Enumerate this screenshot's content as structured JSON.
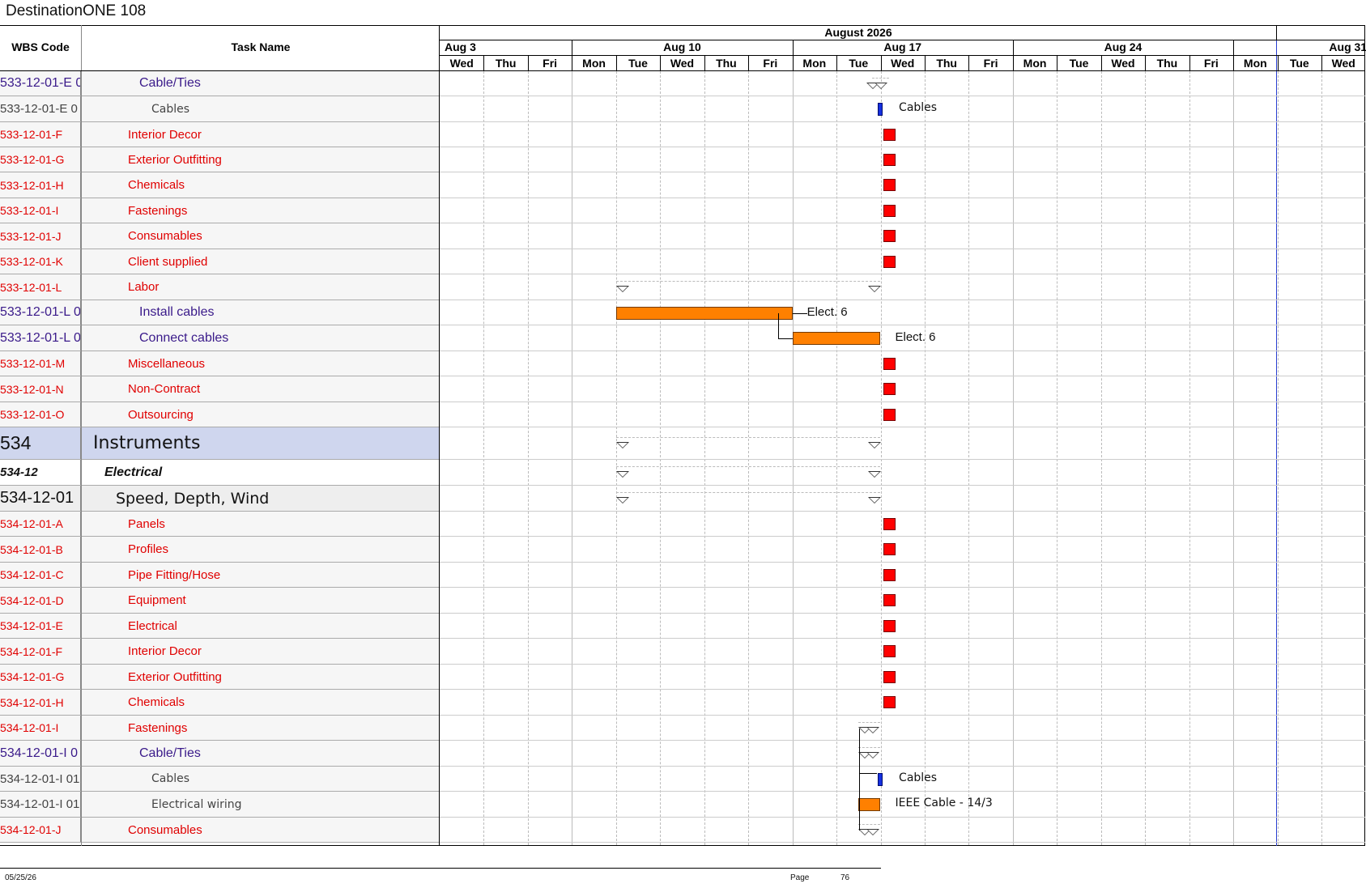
{
  "title": "DestinationONE 108",
  "header": {
    "wbs_label": "WBS Code",
    "task_label": "Task Name",
    "month": "August 2026",
    "weeks": [
      "Aug 3",
      "Aug 10",
      "Aug 17",
      "Aug 24",
      "Aug 31"
    ],
    "days": [
      "Wed",
      "Thu",
      "Fri",
      "Mon",
      "Tue",
      "Wed",
      "Thu",
      "Fri",
      "Mon",
      "Tue",
      "Wed",
      "Thu",
      "Fri",
      "Mon",
      "Tue",
      "Wed",
      "Thu",
      "Fri",
      "Mon",
      "Tue",
      "Wed"
    ]
  },
  "rows": [
    {
      "wbs": "533-12-01-E 0",
      "task": "Cable/Ties",
      "style": "sub",
      "marker": "sumtri",
      "start": 9.8,
      "end": 10.2
    },
    {
      "wbs": "533-12-01-E 0",
      "task": "Cables",
      "style": "item",
      "marker": "blue",
      "start": 9.9,
      "label": "Cables"
    },
    {
      "wbs": "533-12-01-F",
      "task": "Interior Decor",
      "style": "red",
      "marker": "ms",
      "start": 10
    },
    {
      "wbs": "533-12-01-G",
      "task": "Exterior Outfitting",
      "style": "red",
      "marker": "ms",
      "start": 10
    },
    {
      "wbs": "533-12-01-H",
      "task": "Chemicals",
      "style": "red",
      "marker": "ms",
      "start": 10
    },
    {
      "wbs": "533-12-01-I",
      "task": "Fastenings",
      "style": "red",
      "marker": "ms",
      "start": 10
    },
    {
      "wbs": "533-12-01-J",
      "task": "Consumables",
      "style": "red",
      "marker": "ms",
      "start": 10
    },
    {
      "wbs": "533-12-01-K",
      "task": "Client supplied",
      "style": "red",
      "marker": "ms",
      "start": 10
    },
    {
      "wbs": "533-12-01-L",
      "task": "Labor",
      "style": "red",
      "marker": "sum",
      "start": 4,
      "end": 10
    },
    {
      "wbs": "533-12-01-L 0",
      "task": "Install cables",
      "style": "sub",
      "marker": "bar",
      "start": 4,
      "end": 8,
      "label": "Elect. 6"
    },
    {
      "wbs": "533-12-01-L 0",
      "task": "Connect cables",
      "style": "sub",
      "marker": "bar",
      "start": 8,
      "end": 10,
      "label": "Elect. 6"
    },
    {
      "wbs": "533-12-01-M",
      "task": "Miscellaneous",
      "style": "red",
      "marker": "ms",
      "start": 10
    },
    {
      "wbs": "533-12-01-N",
      "task": "Non-Contract",
      "style": "red",
      "marker": "ms",
      "start": 10
    },
    {
      "wbs": "533-12-01-O",
      "task": "Outsourcing",
      "style": "red",
      "marker": "ms",
      "start": 10
    },
    {
      "wbs": "534",
      "task": "Instruments",
      "style": "l1",
      "marker": "sum",
      "start": 4,
      "end": 10
    },
    {
      "wbs": "534-12",
      "task": "Electrical",
      "style": "l2",
      "marker": "sum",
      "start": 4,
      "end": 10
    },
    {
      "wbs": "534-12-01",
      "task": "Speed, Depth, Wind",
      "style": "l3",
      "marker": "sum",
      "start": 4,
      "end": 10
    },
    {
      "wbs": "534-12-01-A",
      "task": "Panels",
      "style": "red",
      "marker": "ms",
      "start": 10
    },
    {
      "wbs": "534-12-01-B",
      "task": "Profiles",
      "style": "red",
      "marker": "ms",
      "start": 10
    },
    {
      "wbs": "534-12-01-C",
      "task": "Pipe Fitting/Hose",
      "style": "red",
      "marker": "ms",
      "start": 10
    },
    {
      "wbs": "534-12-01-D",
      "task": "Equipment",
      "style": "red",
      "marker": "ms",
      "start": 10
    },
    {
      "wbs": "534-12-01-E",
      "task": "Electrical",
      "style": "red",
      "marker": "ms",
      "start": 10
    },
    {
      "wbs": "534-12-01-F",
      "task": "Interior Decor",
      "style": "red",
      "marker": "ms",
      "start": 10
    },
    {
      "wbs": "534-12-01-G",
      "task": "Exterior Outfitting",
      "style": "red",
      "marker": "ms",
      "start": 10
    },
    {
      "wbs": "534-12-01-H",
      "task": "Chemicals",
      "style": "red",
      "marker": "ms",
      "start": 10
    },
    {
      "wbs": "534-12-01-I",
      "task": "Fastenings",
      "style": "red",
      "marker": "sumtri",
      "start": 9.5,
      "end": 10
    },
    {
      "wbs": "534-12-01-I 0",
      "task": "Cable/Ties",
      "style": "sub",
      "marker": "sumtri",
      "start": 9.5,
      "end": 10
    },
    {
      "wbs": "534-12-01-I 01",
      "task": "Cables",
      "style": "item",
      "marker": "blue",
      "start": 9.9,
      "label": "Cables"
    },
    {
      "wbs": "534-12-01-I 01",
      "task": "Electrical wiring",
      "style": "item",
      "marker": "bar",
      "start": 9.5,
      "end": 10,
      "label": "IEEE Cable - 14/3"
    },
    {
      "wbs": "534-12-01-J",
      "task": "Consumables",
      "style": "red",
      "marker": "sumtri",
      "start": 9.5,
      "end": 10
    }
  ],
  "footer": {
    "date": "05/25/26",
    "page_label": "Page",
    "page_number": "76"
  },
  "colors": {
    "red": "#e00000",
    "sub": "#3a1a8a",
    "item": "#444444",
    "l1_bg": "#cfd6ee",
    "milestone": "#ff0000",
    "bar": "#ff8000",
    "blue_ms": "#1530e0"
  }
}
